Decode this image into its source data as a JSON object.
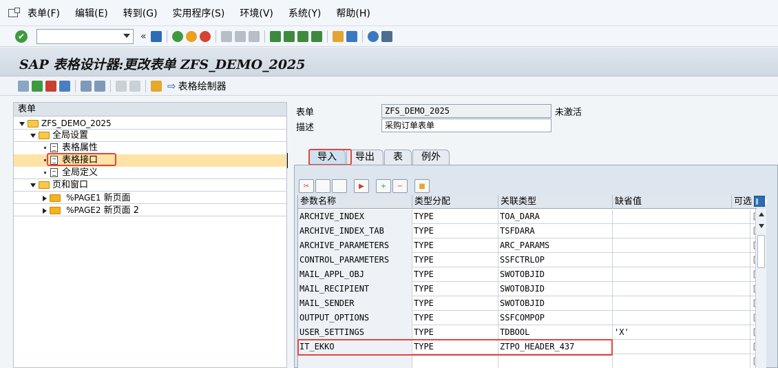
{
  "menu": {
    "items": [
      "表单(F)",
      "编辑(E)",
      "转到(G)",
      "实用程序(S)",
      "环境(V)",
      "系统(Y)",
      "帮助(H)"
    ]
  },
  "toolbar": {
    "command_value": "",
    "back_glyph": "«"
  },
  "title": "SAP 表格设计器:更改表单 ZFS_DEMO_2025",
  "app_toolbar": {
    "form_painter_label": "表格绘制器"
  },
  "tree": {
    "header": "表单",
    "root": "ZFS_DEMO_2025",
    "global_settings": "全局设置",
    "form_attributes": "表格属性",
    "form_interface": "表格接口",
    "global_definitions": "全局定义",
    "pages_windows": "页和窗口",
    "page1_code": "%PAGE1",
    "page1_name": "新页面",
    "page2_code": "%PAGE2",
    "page2_name": "新页面 2"
  },
  "form": {
    "form_label": "表单",
    "form_value": "ZFS_DEMO_2025",
    "status": "未激活",
    "desc_label": "描述",
    "desc_value": "采购订单表单"
  },
  "tabs": [
    "导入",
    "导出",
    "表",
    "例外"
  ],
  "grid": {
    "headers": [
      "参数名称",
      "类型分配",
      "关联类型",
      "缺省值",
      "可选"
    ],
    "rows": [
      {
        "name": "ARCHIVE_INDEX",
        "typing": "TYPE",
        "ref": "TOA_DARA",
        "default": ""
      },
      {
        "name": "ARCHIVE_INDEX_TAB",
        "typing": "TYPE",
        "ref": "TSFDARA",
        "default": ""
      },
      {
        "name": "ARCHIVE_PARAMETERS",
        "typing": "TYPE",
        "ref": "ARC_PARAMS",
        "default": ""
      },
      {
        "name": "CONTROL_PARAMETERS",
        "typing": "TYPE",
        "ref": "SSFCTRLOP",
        "default": ""
      },
      {
        "name": "MAIL_APPL_OBJ",
        "typing": "TYPE",
        "ref": "SWOTOBJID",
        "default": ""
      },
      {
        "name": "MAIL_RECIPIENT",
        "typing": "TYPE",
        "ref": "SWOTOBJID",
        "default": ""
      },
      {
        "name": "MAIL_SENDER",
        "typing": "TYPE",
        "ref": "SWOTOBJID",
        "default": ""
      },
      {
        "name": "OUTPUT_OPTIONS",
        "typing": "TYPE",
        "ref": "SSFCOMPOP",
        "default": ""
      },
      {
        "name": "USER_SETTINGS",
        "typing": "TYPE",
        "ref": "TDBOOL",
        "default": "'X'"
      },
      {
        "name": "IT_EKKO",
        "typing": "TYPE",
        "ref": "ZTPO_HEADER_437",
        "default": ""
      },
      {
        "name": "",
        "typing": "",
        "ref": "",
        "default": ""
      }
    ]
  },
  "colors": {
    "highlight_red": "#e8433e",
    "selected_row": "#fde3a6",
    "accent_blue": "#1e5aa8"
  }
}
